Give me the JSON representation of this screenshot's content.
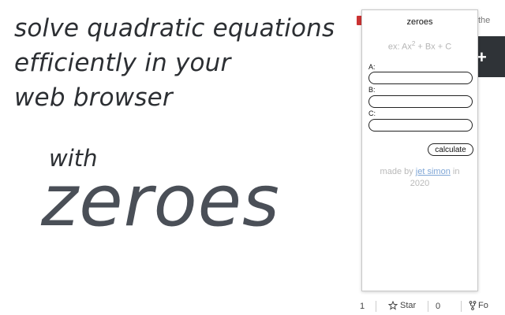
{
  "promo": {
    "lines": [
      "solve quadratic equations",
      "efficiently in your",
      "web browser"
    ],
    "with": "with",
    "brand": "zeroes"
  },
  "browser_bg": {
    "tab_fragment": "the",
    "star_count_left": "1",
    "star_label": "Star",
    "count_mid": "0",
    "fork_label": "Fo"
  },
  "popup": {
    "title": "zeroes",
    "example_prefix": "ex: Ax",
    "example_sup": "2",
    "example_suffix": " + Bx + C",
    "fields": [
      {
        "label": "A:",
        "value": "",
        "placeholder": ""
      },
      {
        "label": "B:",
        "value": "",
        "placeholder": ""
      },
      {
        "label": "C:",
        "value": "",
        "placeholder": ""
      }
    ],
    "calculate_label": "calculate",
    "credit_prefix": "made by ",
    "credit_link": "jet simon",
    "credit_suffix": " in",
    "credit_year": "2020"
  },
  "colors": {
    "promo_text": "#2c2f33",
    "brand_text": "#4a4f57",
    "muted": "#b5b5b5",
    "link": "#7fa6d6"
  }
}
